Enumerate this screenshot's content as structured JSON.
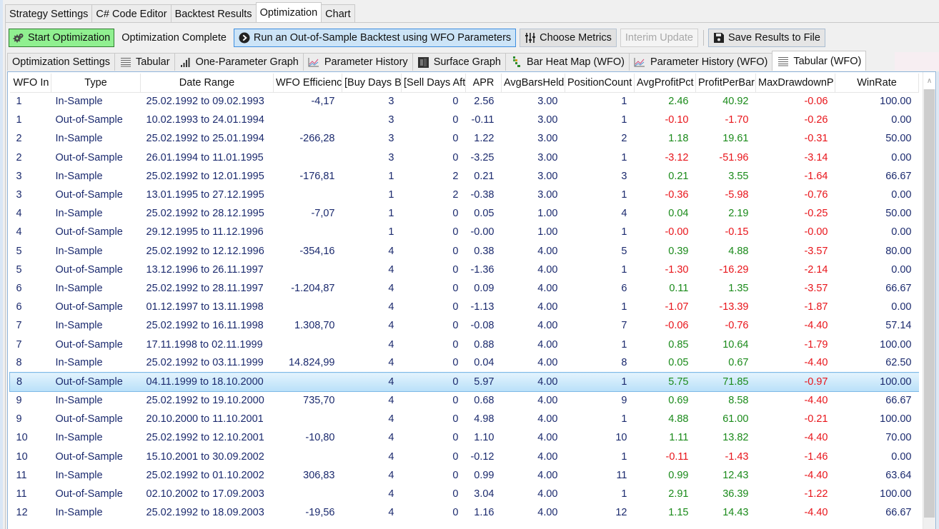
{
  "top_tabs": [
    {
      "label": "Strategy Settings",
      "active": false
    },
    {
      "label": "C# Code Editor",
      "active": false
    },
    {
      "label": "Backtest Results",
      "active": false
    },
    {
      "label": "Optimization",
      "active": true
    },
    {
      "label": "Chart",
      "active": false
    }
  ],
  "toolbar": {
    "start_label": "Start Optimization",
    "start_icon": "gears-icon",
    "status": "Optimization Complete",
    "run_oos_label": "Run an Out-of-Sample Backtest using WFO Parameters",
    "run_oos_icon": "play-circle-icon",
    "choose_metrics_label": "Choose Metrics",
    "choose_metrics_icon": "sliders-icon",
    "interim_update_label": "Interim Update",
    "save_label": "Save Results to File",
    "save_icon": "floppy-disk-icon"
  },
  "sub_tabs": [
    {
      "label": "Optimization Settings",
      "icon": null,
      "active": false
    },
    {
      "label": "Tabular",
      "icon": "table-lines-icon",
      "active": false
    },
    {
      "label": "One-Parameter Graph",
      "icon": "bar-chart-icon",
      "active": false
    },
    {
      "label": "Parameter History",
      "icon": "line-chart-icon",
      "active": false
    },
    {
      "label": "Surface Graph",
      "icon": "surface-icon",
      "active": false
    },
    {
      "label": "Bar Heat Map (WFO)",
      "icon": "heatmap-icon",
      "active": false
    },
    {
      "label": "Parameter History (WFO)",
      "icon": "line-chart-icon",
      "active": false
    },
    {
      "label": "Tabular (WFO)",
      "icon": "table-lines-icon",
      "active": true
    }
  ],
  "colors": {
    "positive": "#1a8a1a",
    "negative": "#e8141a",
    "text": "#1b2a6e",
    "selection": "#b9e0f9"
  },
  "grid": {
    "columns": [
      "WFO In",
      "Type",
      "Date Range",
      "WFO Efficienc",
      "[Buy Days B",
      "[Sell Days Aft",
      "APR",
      "AvgBarsHeld",
      "PositionCount",
      "AvgProfitPct",
      "ProfitPerBar",
      "MaxDrawdownP",
      "WinRate"
    ],
    "selected_row": 15,
    "rows": [
      [
        "1",
        "In-Sample",
        "25.02.1992 to 09.02.1993",
        "-4,17",
        "3",
        "0",
        "2.56",
        "3.00",
        "1",
        "2.46",
        "40.92",
        "-0.06",
        "100.00"
      ],
      [
        "1",
        "Out-of-Sample",
        "10.02.1993 to 24.01.1994",
        "",
        "3",
        "0",
        "-0.11",
        "3.00",
        "1",
        "-0.10",
        "-1.70",
        "-0.26",
        "0.00"
      ],
      [
        "2",
        "In-Sample",
        "25.02.1992 to 25.01.1994",
        "-266,28",
        "3",
        "0",
        "1.22",
        "3.00",
        "2",
        "1.18",
        "19.61",
        "-0.31",
        "50.00"
      ],
      [
        "2",
        "Out-of-Sample",
        "26.01.1994 to 11.01.1995",
        "",
        "3",
        "0",
        "-3.25",
        "3.00",
        "1",
        "-3.12",
        "-51.96",
        "-3.14",
        "0.00"
      ],
      [
        "3",
        "In-Sample",
        "25.02.1992 to 12.01.1995",
        "-176,81",
        "1",
        "2",
        "0.21",
        "3.00",
        "3",
        "0.21",
        "3.55",
        "-1.64",
        "66.67"
      ],
      [
        "3",
        "Out-of-Sample",
        "13.01.1995 to 27.12.1995",
        "",
        "1",
        "2",
        "-0.38",
        "3.00",
        "1",
        "-0.36",
        "-5.98",
        "-0.76",
        "0.00"
      ],
      [
        "4",
        "In-Sample",
        "25.02.1992 to 28.12.1995",
        "-7,07",
        "1",
        "0",
        "0.05",
        "1.00",
        "4",
        "0.04",
        "2.19",
        "-0.25",
        "50.00"
      ],
      [
        "4",
        "Out-of-Sample",
        "29.12.1995 to 11.12.1996",
        "",
        "1",
        "0",
        "-0.00",
        "1.00",
        "1",
        "-0.00",
        "-0.15",
        "-0.00",
        "0.00"
      ],
      [
        "5",
        "In-Sample",
        "25.02.1992 to 12.12.1996",
        "-354,16",
        "4",
        "0",
        "0.38",
        "4.00",
        "5",
        "0.39",
        "4.88",
        "-3.57",
        "80.00"
      ],
      [
        "5",
        "Out-of-Sample",
        "13.12.1996 to 26.11.1997",
        "",
        "4",
        "0",
        "-1.36",
        "4.00",
        "1",
        "-1.30",
        "-16.29",
        "-2.14",
        "0.00"
      ],
      [
        "6",
        "In-Sample",
        "25.02.1992 to 28.11.1997",
        "-1.204,87",
        "4",
        "0",
        "0.09",
        "4.00",
        "6",
        "0.11",
        "1.35",
        "-3.57",
        "66.67"
      ],
      [
        "6",
        "Out-of-Sample",
        "01.12.1997 to 13.11.1998",
        "",
        "4",
        "0",
        "-1.13",
        "4.00",
        "1",
        "-1.07",
        "-13.39",
        "-1.87",
        "0.00"
      ],
      [
        "7",
        "In-Sample",
        "25.02.1992 to 16.11.1998",
        "1.308,70",
        "4",
        "0",
        "-0.08",
        "4.00",
        "7",
        "-0.06",
        "-0.76",
        "-4.40",
        "57.14"
      ],
      [
        "7",
        "Out-of-Sample",
        "17.11.1998 to 02.11.1999",
        "",
        "4",
        "0",
        "0.88",
        "4.00",
        "1",
        "0.85",
        "10.64",
        "-1.79",
        "100.00"
      ],
      [
        "8",
        "In-Sample",
        "25.02.1992 to 03.11.1999",
        "14.824,99",
        "4",
        "0",
        "0.04",
        "4.00",
        "8",
        "0.05",
        "0.67",
        "-4.40",
        "62.50"
      ],
      [
        "8",
        "Out-of-Sample",
        "04.11.1999 to 18.10.2000",
        "",
        "4",
        "0",
        "5.97",
        "4.00",
        "1",
        "5.75",
        "71.85",
        "-0.97",
        "100.00"
      ],
      [
        "9",
        "In-Sample",
        "25.02.1992 to 19.10.2000",
        "735,70",
        "4",
        "0",
        "0.68",
        "4.00",
        "9",
        "0.69",
        "8.58",
        "-4.40",
        "66.67"
      ],
      [
        "9",
        "Out-of-Sample",
        "20.10.2000 to 11.10.2001",
        "",
        "4",
        "0",
        "4.98",
        "4.00",
        "1",
        "4.88",
        "61.00",
        "-0.21",
        "100.00"
      ],
      [
        "10",
        "In-Sample",
        "25.02.1992 to 12.10.2001",
        "-10,80",
        "4",
        "0",
        "1.10",
        "4.00",
        "10",
        "1.11",
        "13.82",
        "-4.40",
        "70.00"
      ],
      [
        "10",
        "Out-of-Sample",
        "15.10.2001 to 30.09.2002",
        "",
        "4",
        "0",
        "-0.12",
        "4.00",
        "1",
        "-0.11",
        "-1.43",
        "-1.46",
        "0.00"
      ],
      [
        "11",
        "In-Sample",
        "25.02.1992 to 01.10.2002",
        "306,83",
        "4",
        "0",
        "0.99",
        "4.00",
        "11",
        "0.99",
        "12.43",
        "-4.40",
        "63.64"
      ],
      [
        "11",
        "Out-of-Sample",
        "02.10.2002 to 17.09.2003",
        "",
        "4",
        "0",
        "3.04",
        "4.00",
        "1",
        "2.91",
        "36.39",
        "-1.22",
        "100.00"
      ],
      [
        "12",
        "In-Sample",
        "25.02.1992 to 18.09.2003",
        "-19,56",
        "4",
        "0",
        "1.16",
        "4.00",
        "12",
        "1.15",
        "14.43",
        "-4.40",
        "66.67"
      ]
    ]
  }
}
